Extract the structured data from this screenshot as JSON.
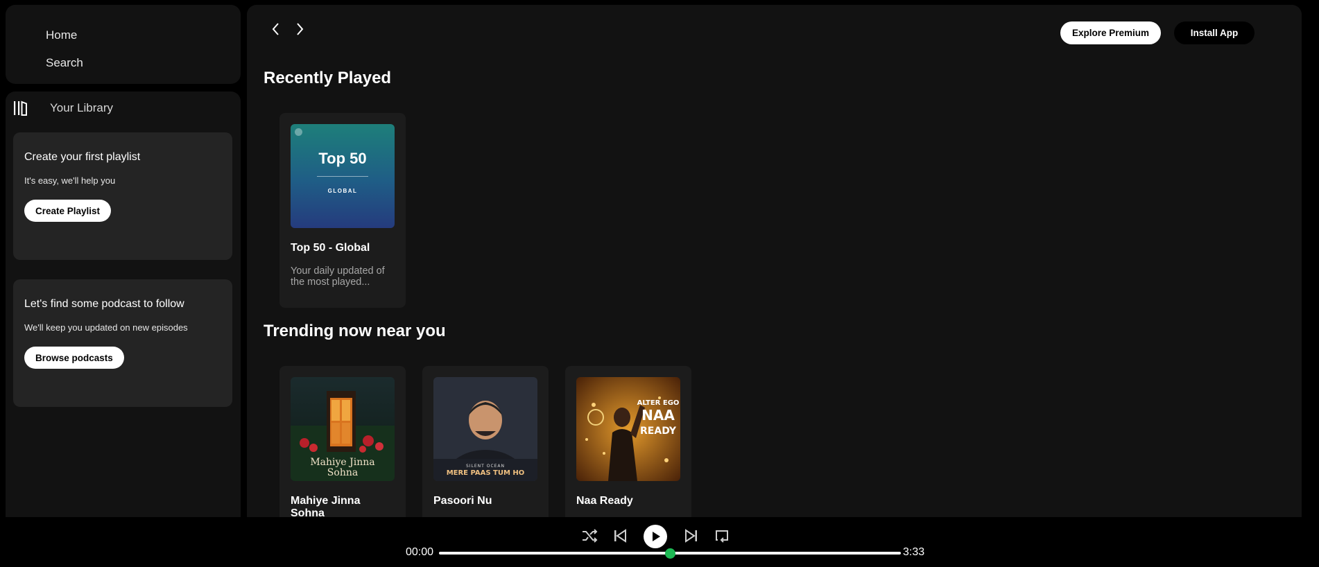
{
  "sidebar": {
    "nav": {
      "home": "Home",
      "search": "Search"
    },
    "library": {
      "title": "Your Library",
      "cards": [
        {
          "title": "Create your first playlist",
          "text": "It's easy, we'll help you",
          "button": "Create Playlist"
        },
        {
          "title": "Let's find some podcast to follow",
          "text": "We'll keep you updated on new episodes",
          "button": "Browse podcasts"
        }
      ]
    }
  },
  "header": {
    "premium_button": "Explore Premium",
    "install_button": "Install App"
  },
  "recently_played": {
    "title": "Recently Played",
    "items": [
      {
        "name": "Top 50 - Global",
        "description": "Your daily updated of the most played...",
        "cover_title": "Top 50",
        "cover_subtitle": "GLOBAL"
      }
    ]
  },
  "trending": {
    "title": "Trending now near you",
    "items": [
      {
        "name": "Mahiye Jinna Sohna",
        "cover_text": "Mahiye Jinna Sohna"
      },
      {
        "name": "Pasoori Nu",
        "cover_text": "MERE PAAS TUM HO",
        "cover_subtext": "SILENT OCEAN"
      },
      {
        "name": "Naa Ready",
        "cover_text": "NAA READY",
        "cover_subtext": "ALTER EGO"
      }
    ]
  },
  "player": {
    "current_time": "00:00",
    "total_time": "3:33",
    "progress": 0.5,
    "accent_color": "#1db954"
  }
}
